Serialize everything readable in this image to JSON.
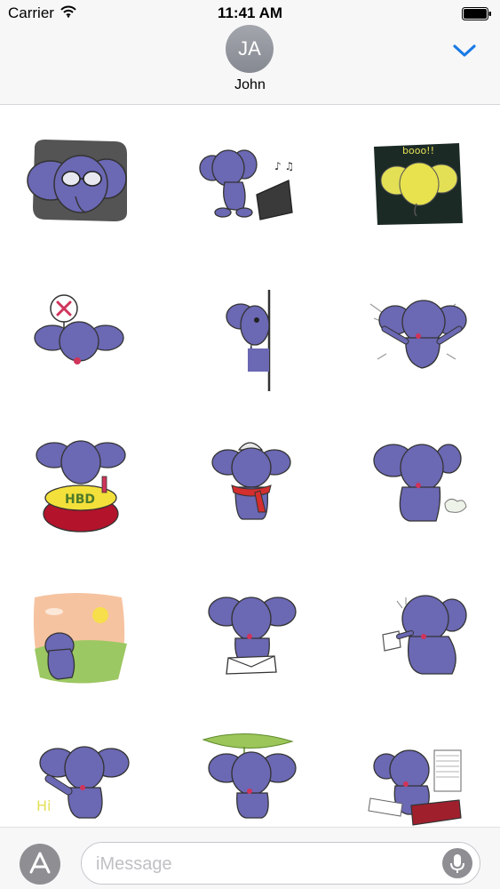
{
  "status_bar": {
    "carrier": "Carrier",
    "time": "11:41 AM"
  },
  "header": {
    "contact_initials": "JA",
    "contact_name": "John",
    "collapse_icon": "chevron-down-icon",
    "accent_color": "#1a7ae6"
  },
  "stickers": [
    {
      "name": "elephant-glasses-sticker",
      "text": ""
    },
    {
      "name": "elephant-piano-sticker",
      "text": ""
    },
    {
      "name": "elephant-booo-sticker",
      "text": "booo!!"
    },
    {
      "name": "elephant-no-sign-sticker",
      "text": ""
    },
    {
      "name": "elephant-peek-wall-sticker",
      "text": ""
    },
    {
      "name": "elephant-cheer-sticker",
      "text": ""
    },
    {
      "name": "elephant-hbd-cake-sticker",
      "text": "HBD"
    },
    {
      "name": "elephant-scarf-sticker",
      "text": ""
    },
    {
      "name": "elephant-sneeze-sticker",
      "text": ""
    },
    {
      "name": "elephant-sunset-sticker",
      "text": ""
    },
    {
      "name": "elephant-letter-sticker",
      "text": ""
    },
    {
      "name": "elephant-tissue-sticker",
      "text": ""
    },
    {
      "name": "elephant-hi-sticker",
      "text": "Hi"
    },
    {
      "name": "elephant-leaf-umbrella-sticker",
      "text": ""
    },
    {
      "name": "elephant-paperwork-sticker",
      "text": ""
    }
  ],
  "composer": {
    "placeholder": "iMessage",
    "app_store_icon": "app-store-icon",
    "mic_icon": "microphone-icon"
  },
  "colors": {
    "elephant": "#6b68b4",
    "elephant_dark": "#4d4a8c",
    "ear_inner": "#8d8acb",
    "tongue": "#d0345a"
  }
}
